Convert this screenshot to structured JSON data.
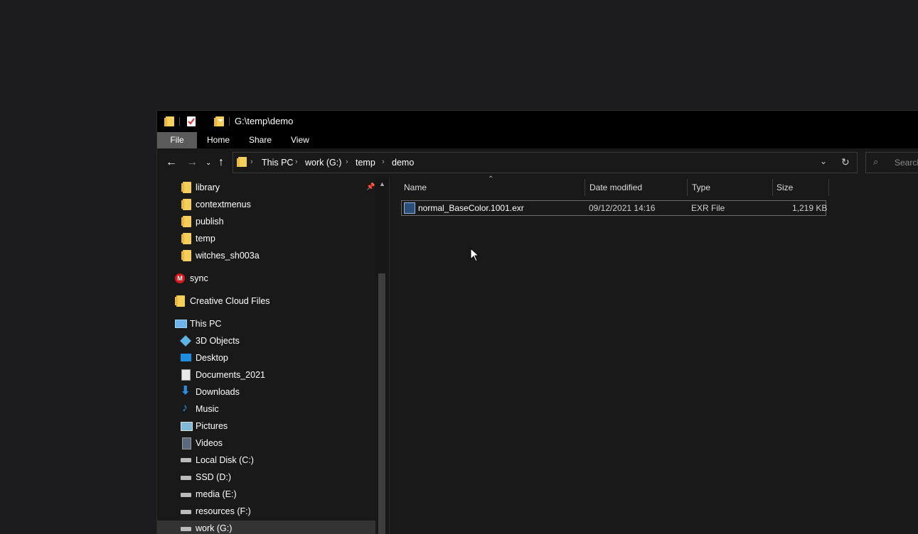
{
  "window": {
    "title": "G:\\temp\\demo"
  },
  "ribbon": {
    "tabs": [
      "File",
      "Home",
      "Share",
      "View"
    ]
  },
  "address": {
    "crumbs": [
      "This PC",
      "work (G:)",
      "temp",
      "demo"
    ]
  },
  "search": {
    "placeholder": "Search"
  },
  "sidebar": {
    "quick_folders": [
      "library",
      "contextmenus",
      "publish",
      "temp",
      "witches_sh003a"
    ],
    "sync": "sync",
    "creative_cloud": "Creative Cloud Files",
    "this_pc": "This PC",
    "pc_items": [
      "3D Objects",
      "Desktop",
      "Documents_2021",
      "Downloads",
      "Music",
      "Pictures",
      "Videos",
      "Local Disk (C:)",
      "SSD (D:)",
      "media (E:)",
      "resources (F:)",
      "work (G:)"
    ]
  },
  "columns": {
    "name": "Name",
    "date": "Date modified",
    "type": "Type",
    "size": "Size"
  },
  "files": [
    {
      "name": "normal_BaseColor.1001.exr",
      "date": "09/12/2021 14:16",
      "type": "EXR File",
      "size": "1,219 KB"
    }
  ],
  "colors": {
    "window_bg": "#191919",
    "titlebar_bg": "#000000",
    "file_tab_bg": "#5b5b5b",
    "folder": "#f5cf5b"
  }
}
